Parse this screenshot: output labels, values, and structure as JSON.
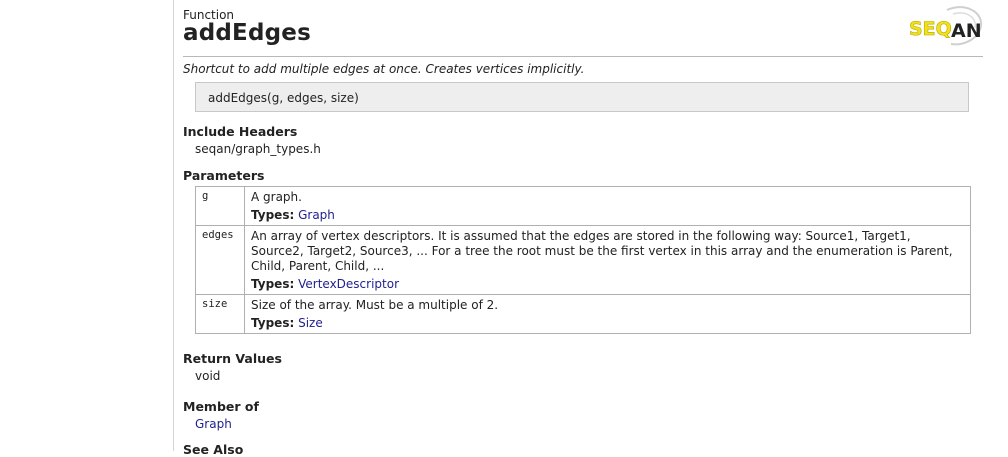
{
  "header": {
    "kind": "Function",
    "title": "addEdges",
    "logo_text": "SEQAN"
  },
  "summary": "Shortcut to add multiple edges at once. Creates vertices implicitly.",
  "signature": "addEdges(g, edges, size)",
  "include_headers": {
    "title": "Include Headers",
    "value": "seqan/graph_types.h"
  },
  "parameters": {
    "title": "Parameters",
    "types_label": "Types:",
    "rows": [
      {
        "name": "g",
        "description": "A graph.",
        "type": "Graph"
      },
      {
        "name": "edges",
        "description": "An array of vertex descriptors. It is assumed that the edges are stored in the following way: Source1, Target1, Source2, Target2, Source3, ... For a tree the root must be the first vertex in this array and the enumeration is Parent, Child, Parent, Child, ...",
        "type": "VertexDescriptor"
      },
      {
        "name": "size",
        "description": "Size of the array. Must be a multiple of 2.",
        "type": "Size"
      }
    ]
  },
  "return_values": {
    "title": "Return Values",
    "value": "void"
  },
  "member_of": {
    "title": "Member of",
    "value": "Graph"
  },
  "see_also": {
    "title": "See Also"
  },
  "colors": {
    "link": "#1f1f8f",
    "logo_yellow": "#f2e21a",
    "logo_dark": "#222222",
    "signature_bg": "#eeeeee"
  }
}
